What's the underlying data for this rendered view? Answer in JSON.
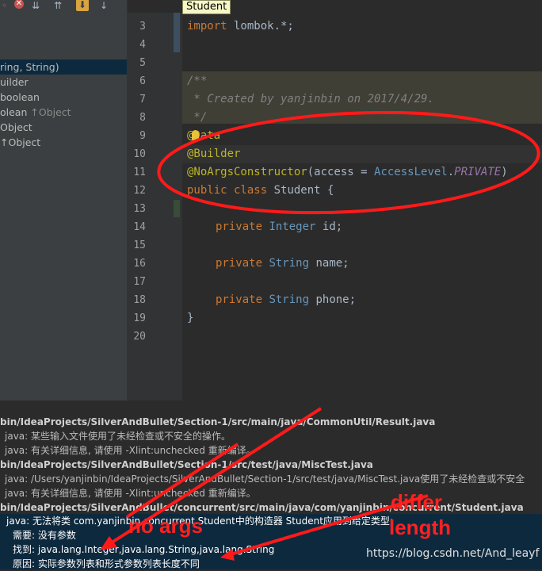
{
  "toolbar": {
    "icons": [
      "sort-icon",
      "close-icon",
      "collapse-icon",
      "expand-icon",
      "autoscroll-icon",
      "scroll-down-icon"
    ]
  },
  "tab_tooltip": "Student",
  "structure": [
    {
      "text": "ring, String)",
      "suffix": "",
      "selected": true
    },
    {
      "text": "uilder",
      "suffix": "",
      "selected": false
    },
    {
      "text": "boolean",
      "suffix": "",
      "selected": false
    },
    {
      "text": "olean",
      "suffix": " ↑Object",
      "selected": false
    },
    {
      "text": "Object",
      "suffix": "",
      "selected": false
    },
    {
      "text": "↑Object",
      "suffix": "",
      "selected": false
    }
  ],
  "editor": {
    "line_numbers": [
      "3",
      "4",
      "5",
      "6",
      "7",
      "8",
      "9",
      "10",
      "11",
      "12",
      "13",
      "14",
      "15",
      "16",
      "17",
      "18",
      "19",
      "20"
    ],
    "lines": {
      "l3": {
        "kw": "import",
        "rest": " lombok.*;"
      },
      "l6": "/**",
      "l7": " * Created by yanjinbin on 2017/4/29.",
      "l8": " */",
      "l9": "@Data",
      "l10": "@Builder",
      "l11": {
        "ann": "@NoArgsConstructor",
        "p1": "(access = ",
        "type": "AccessLevel",
        "dot": ".",
        "const": "PRIVATE",
        "p2": ")"
      },
      "l12": {
        "kw": "public class",
        "rest": " Student {"
      },
      "l14": {
        "kw": "private",
        "type": "Integer",
        "rest": " id;"
      },
      "l16": {
        "kw": "private",
        "type": "String",
        "rest": " name;"
      },
      "l18": {
        "kw": "private",
        "type": "String",
        "rest": " phone;"
      },
      "l19": "}"
    }
  },
  "console": {
    "rows": [
      {
        "text": "bin/IdeaProjects/SilverAndBullet/Section-1/src/main/java/CommonUtil/Result.java",
        "kind": "hdr"
      },
      {
        "text": "java: 某些输入文件使用了未经检查或不安全的操作。",
        "kind": "sub"
      },
      {
        "text": "java: 有关详细信息, 请使用 -Xlint:unchecked 重新编译。",
        "kind": "sub"
      },
      {
        "text": "bin/IdeaProjects/SilverAndBullet/Section-1/src/test/java/MiscTest.java",
        "kind": "hdr"
      },
      {
        "text": "java: /Users/yanjinbin/IdeaProjects/SilverAndBullet/Section-1/src/test/java/MiscTest.java使用了未经检查或不安全",
        "kind": "sub"
      },
      {
        "text": "java: 有关详细信息, 请使用 -Xlint:unchecked 重新编译。",
        "kind": "sub"
      },
      {
        "text": "bin/IdeaProjects/SilverAndBullet/concurrent/src/main/java/com/yanjinbin/concurrent/Student.java",
        "kind": "hdr"
      }
    ],
    "error": {
      "line1": "java: 无法将类 com.yanjinbin.concurrent.Student中的构造器 Student应用到给定类型;",
      "line2": "需要: 没有参数",
      "line3": "找到: java.lang.Integer,java.lang.String,java.lang.String",
      "line4": "原因: 实际参数列表和形式参数列表长度不同"
    }
  },
  "annotations": {
    "no_args": "no args",
    "differ": "differ",
    "length": "length",
    "color": "#ff2020"
  },
  "watermark": "https://blog.csdn.net/And_leayf"
}
